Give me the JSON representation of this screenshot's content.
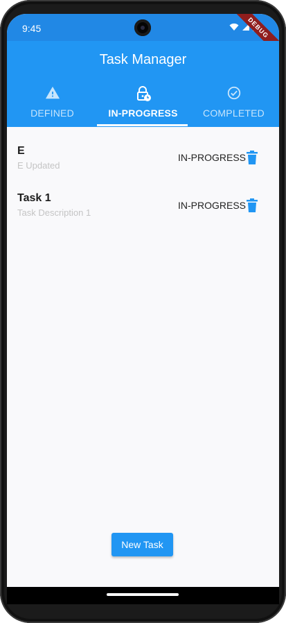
{
  "status_bar": {
    "time": "9:45",
    "debug_label": "DEBUG"
  },
  "app_bar": {
    "title": "Task Manager"
  },
  "tabs": [
    {
      "label": "DEFINED",
      "icon": "warning-icon",
      "active": false
    },
    {
      "label": "IN-PROGRESS",
      "icon": "lock-clock-icon",
      "active": true
    },
    {
      "label": "COMPLETED",
      "icon": "check-circle-icon",
      "active": false
    }
  ],
  "tasks": [
    {
      "name": "E",
      "description": "E Updated",
      "status": "IN-PROGRESS"
    },
    {
      "name": "Task 1",
      "description": "Task Description 1",
      "status": "IN-PROGRESS"
    }
  ],
  "new_task_button": {
    "label": "New Task"
  },
  "colors": {
    "primary": "#2196f3",
    "status_bar": "#2188e5",
    "background": "#f9f9fb"
  }
}
